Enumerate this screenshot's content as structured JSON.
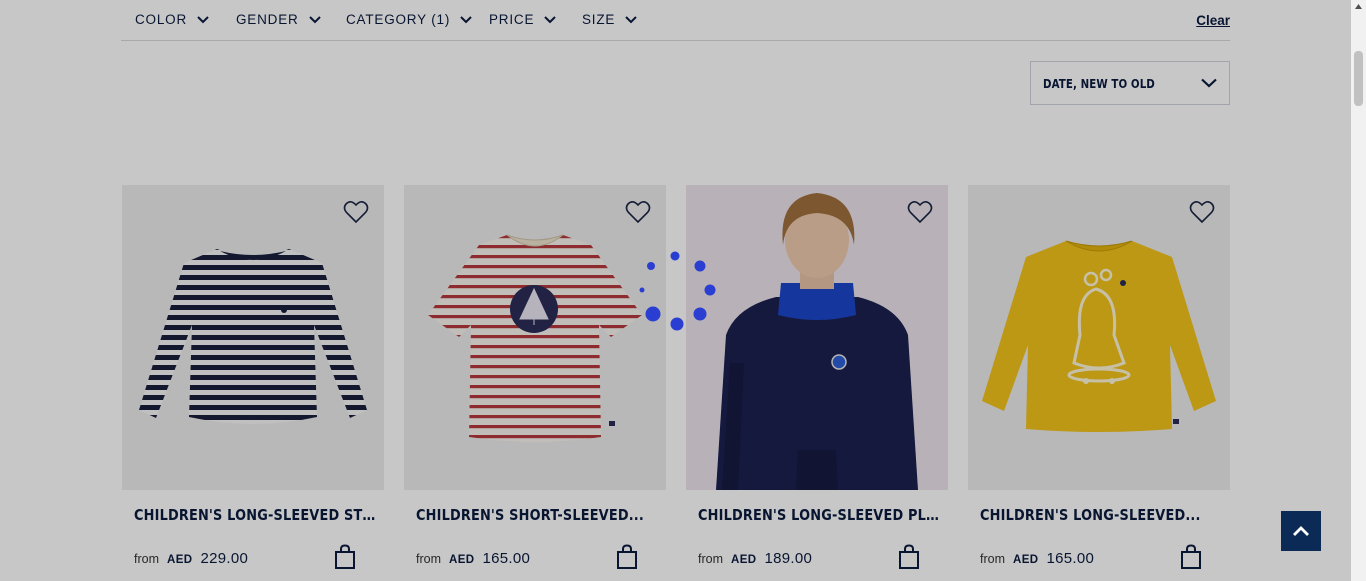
{
  "filters": {
    "items": [
      {
        "label": "COLOR"
      },
      {
        "label": "GENDER"
      },
      {
        "label": "CATEGORY (1)"
      },
      {
        "label": "PRICE"
      },
      {
        "label": "SIZE"
      }
    ],
    "clear_label": "Clear"
  },
  "sort": {
    "selected": "DATE, NEW TO OLD"
  },
  "products": [
    {
      "title": "CHILDREN'S LONG-SLEEVED STRIPED T-SHIRT",
      "from": "from",
      "currency": "AED",
      "price": "229.00",
      "icon": "striped-long-sleeve-shirt-image"
    },
    {
      "title": "CHILDREN'S SHORT-SLEEVED...",
      "from": "from",
      "currency": "AED",
      "price": "165.00",
      "icon": "striped-short-sleeve-tshirt-image"
    },
    {
      "title": "CHILDREN'S LONG-SLEEVED PLAIN SWEATSHIRT",
      "from": "from",
      "currency": "AED",
      "price": "189.00",
      "icon": "child-model-photo"
    },
    {
      "title": "CHILDREN'S LONG-SLEEVED...",
      "from": "from",
      "currency": "AED",
      "price": "165.00",
      "icon": "yellow-long-sleeve-shirt-image"
    }
  ],
  "colors": {
    "navy": "#0b1b3f",
    "spinner": "#2a3ed1",
    "back_to_top": "#0b2a55"
  }
}
